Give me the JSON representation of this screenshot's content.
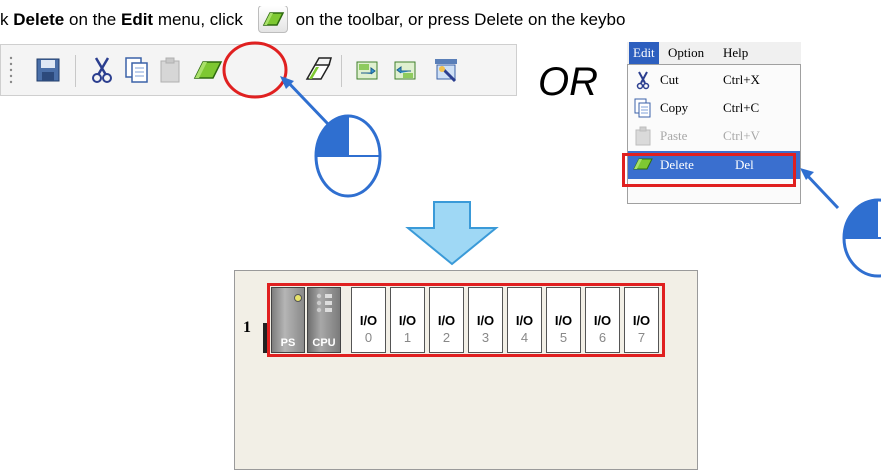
{
  "instruction": {
    "part1": "k ",
    "delete_word": "Delete",
    "part2": " on the ",
    "edit_word": "Edit",
    "part3": " menu, click ",
    "part4": "on the toolbar, or press Delete on the keybo"
  },
  "toolbar": {
    "icons": [
      "save-icon",
      "cut-icon",
      "copy-icon",
      "paste-icon",
      "delete-eraser-icon",
      "tool-icon",
      "upload-icon",
      "download-icon",
      "monitor-icon"
    ]
  },
  "or_label": "OR",
  "menu": {
    "bar": [
      "Edit",
      "Option",
      "Help"
    ],
    "items": [
      {
        "label": "Cut",
        "shortcut": "Ctrl+X",
        "icon": "scissors-icon",
        "state": "normal"
      },
      {
        "label": "Copy",
        "shortcut": "Ctrl+C",
        "icon": "copy-icon",
        "state": "normal"
      },
      {
        "label": "Paste",
        "shortcut": "Ctrl+V",
        "icon": "paste-icon",
        "state": "disabled"
      },
      {
        "label": "Delete",
        "shortcut": "Del",
        "icon": "eraser-icon",
        "state": "selected"
      }
    ]
  },
  "rack": {
    "number": "1",
    "modules": [
      "PS",
      "CPU"
    ],
    "io_label": "I/O",
    "slots": [
      "0",
      "1",
      "2",
      "3",
      "4",
      "5",
      "6",
      "7"
    ]
  },
  "colors": {
    "highlight_red": "#e02020",
    "accent_blue": "#3a6fcf",
    "arrow_fill": "#9fd8f5"
  }
}
